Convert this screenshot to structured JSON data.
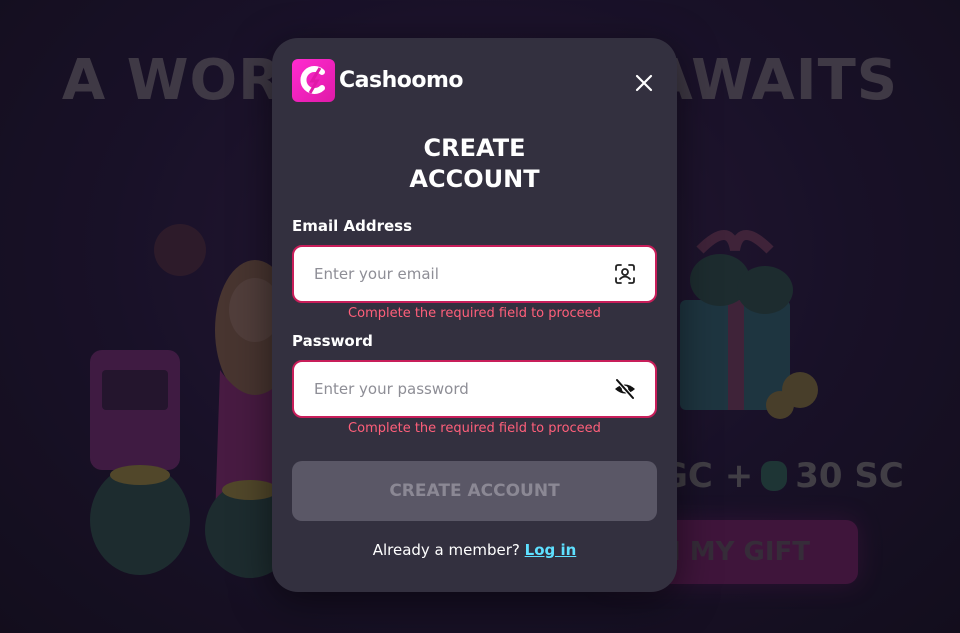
{
  "background": {
    "headline": "A WORLD OF FUN AWAITS",
    "bonus_text_1": "GC +",
    "bonus_text_2": "30 SC",
    "cta_label": "M MY GIFT"
  },
  "brand": {
    "name": "Cashoomo",
    "accent": "#ff2bd0"
  },
  "modal": {
    "title_line1": "CREATE",
    "title_line2": "ACCOUNT",
    "email": {
      "label": "Email Address",
      "placeholder": "Enter your email",
      "value": "",
      "error": "Complete the required field to proceed",
      "icon": "contact-card-icon"
    },
    "password": {
      "label": "Password",
      "placeholder": "Enter your password",
      "value": "",
      "error": "Complete the required field to proceed",
      "icon": "eye-off-icon"
    },
    "submit_label": "CREATE ACCOUNT",
    "member_prompt": "Already a member?",
    "login_label": "Log in",
    "close_icon": "close-icon"
  },
  "colors": {
    "modal_bg": "#33303f",
    "error": "#ff5f7a",
    "field_border_error": "#c81e5a",
    "link": "#5ee0ff",
    "button_disabled": "#5a5766"
  }
}
